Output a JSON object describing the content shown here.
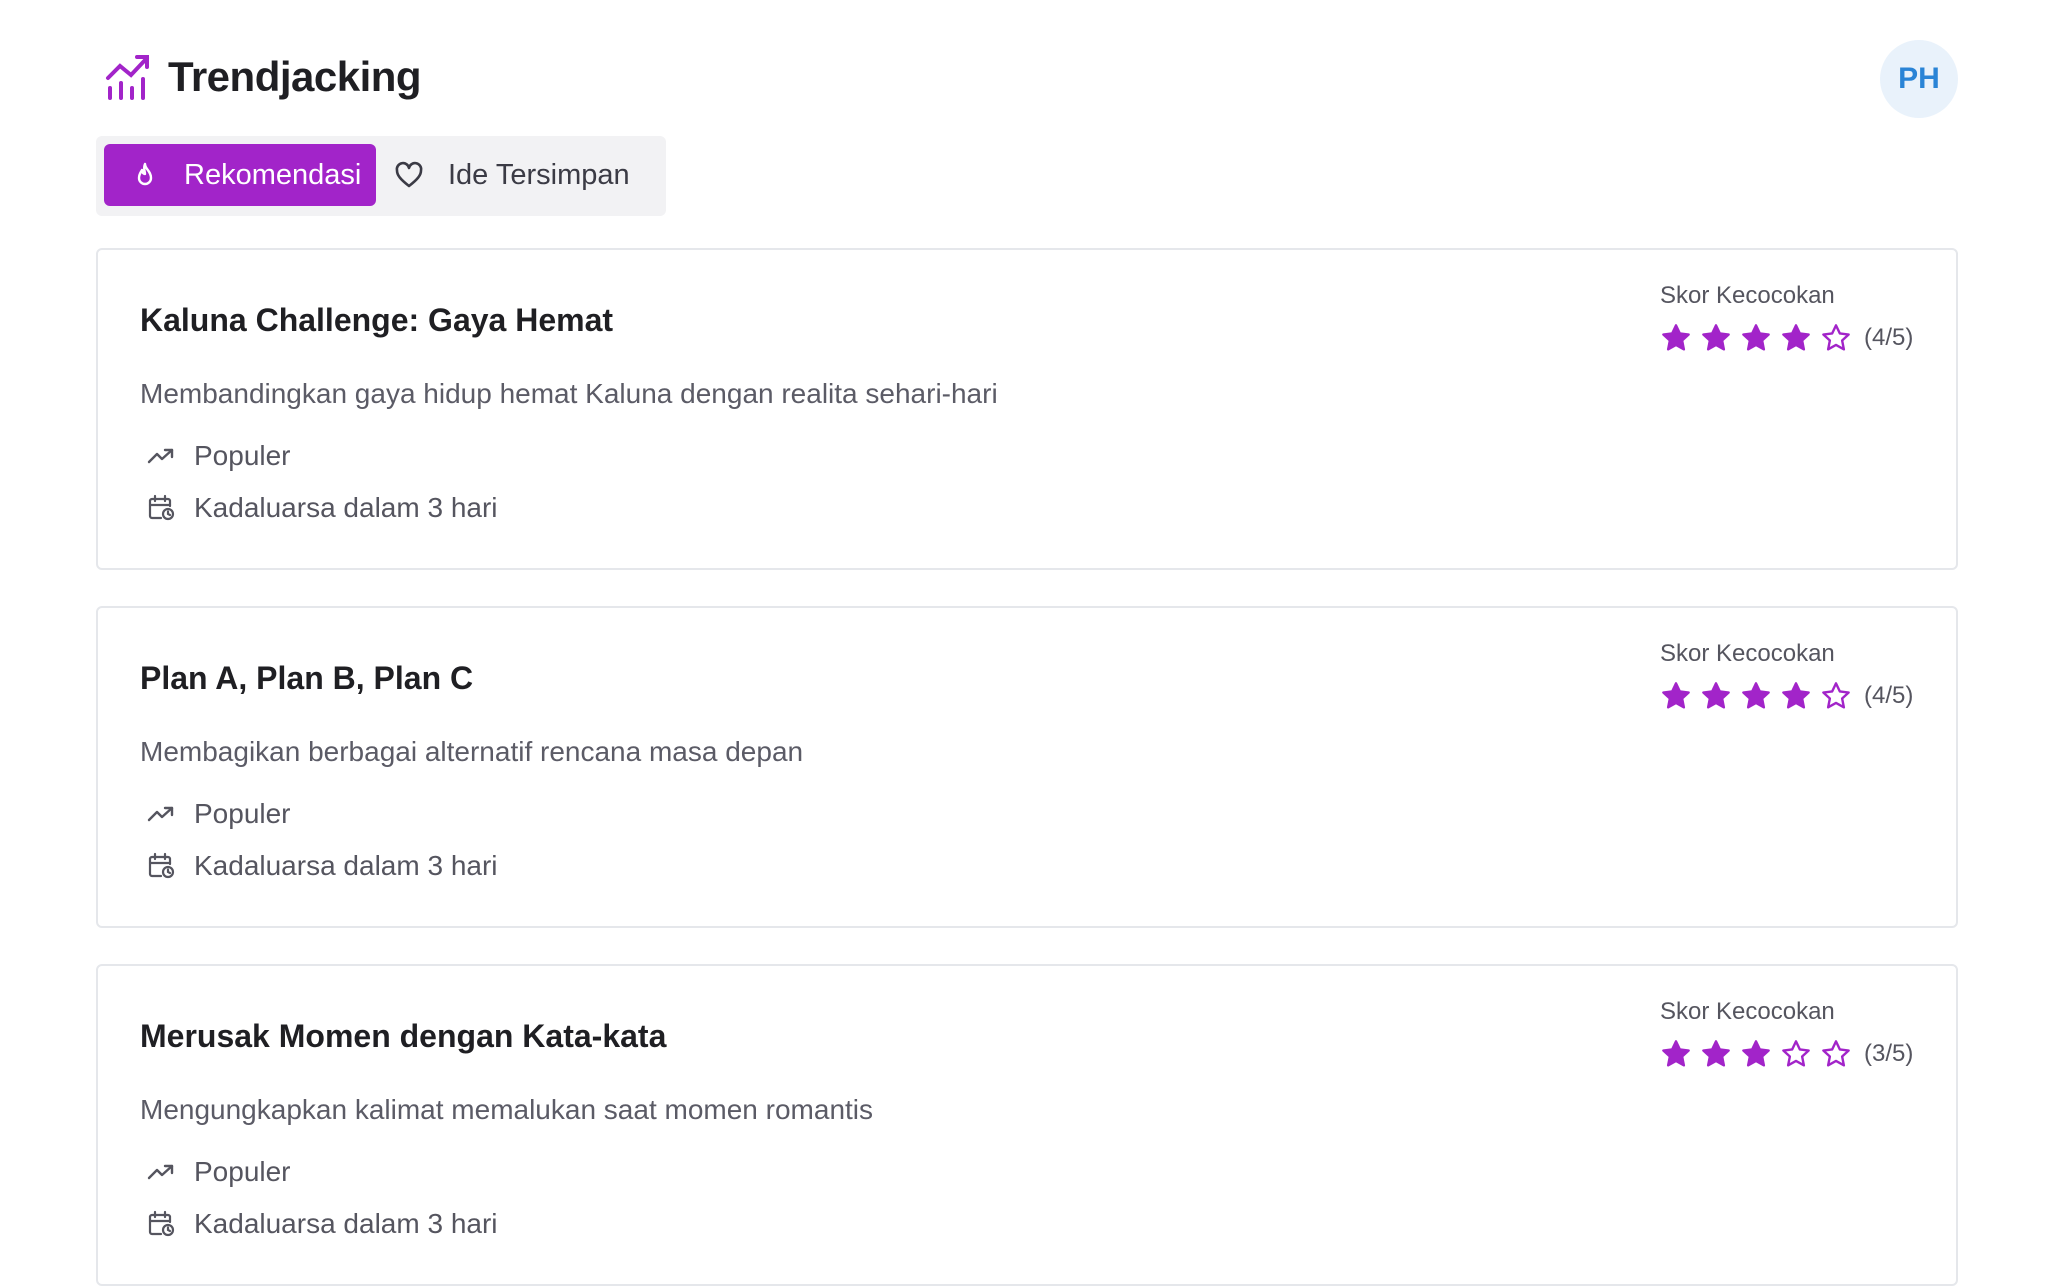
{
  "app": {
    "name": "Trendjacking",
    "brand_color": "#a224c9"
  },
  "user": {
    "initials": "PH"
  },
  "tabs": [
    {
      "label": "Rekomendasi",
      "icon": "flame-icon",
      "active": true
    },
    {
      "label": "Ide Tersimpan",
      "icon": "heart-icon",
      "active": false
    }
  ],
  "cards": [
    {
      "title": "Kaluna Challenge: Gaya Hemat",
      "description": "Membandingkan gaya hidup hemat Kaluna dengan realita sehari-hari",
      "trend": "Populer",
      "expiry": "Kadaluarsa dalam 3 hari",
      "score_label": "Skor Kecocokan",
      "score": 4,
      "score_max": 5,
      "score_text": "(4/5)"
    },
    {
      "title": "Plan A, Plan B, Plan C",
      "description": "Membagikan berbagai alternatif rencana masa depan",
      "trend": "Populer",
      "expiry": "Kadaluarsa dalam 3 hari",
      "score_label": "Skor Kecocokan",
      "score": 4,
      "score_max": 5,
      "score_text": "(4/5)"
    },
    {
      "title": "Merusak Momen dengan Kata-kata",
      "description": "Mengungkapkan kalimat memalukan saat momen romantis",
      "trend": "Populer",
      "expiry": "Kadaluarsa dalam 3 hari",
      "score_label": "Skor Kecocokan",
      "score": 3,
      "score_max": 5,
      "score_text": "(3/5)"
    }
  ]
}
